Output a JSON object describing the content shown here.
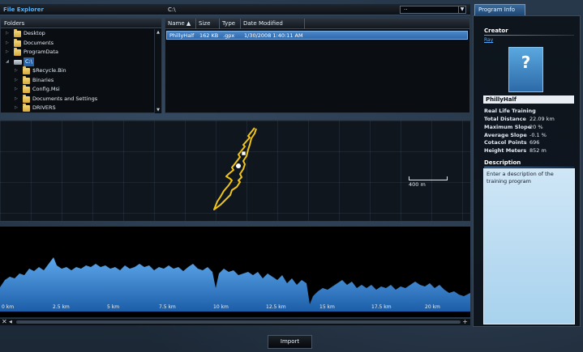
{
  "file_explorer": {
    "title": "File Explorer",
    "path": "C:\\",
    "dropdown_value": "··"
  },
  "folders": {
    "header": "Folders",
    "items": [
      {
        "label": "Desktop",
        "level": 0,
        "expander": "closed"
      },
      {
        "label": "Documents",
        "level": 0,
        "expander": "closed"
      },
      {
        "label": "ProgramData",
        "level": 0,
        "expander": "closed"
      },
      {
        "label": "C:\\",
        "level": 0,
        "expander": "open",
        "icon": "drive-icon",
        "selected": true
      },
      {
        "label": "$Recycle.Bin",
        "level": 1,
        "expander": "closed"
      },
      {
        "label": "Binaries",
        "level": 1,
        "expander": "closed"
      },
      {
        "label": "Config.Msi",
        "level": 1,
        "expander": "closed"
      },
      {
        "label": "Documents and Settings",
        "level": 1,
        "expander": "closed"
      },
      {
        "label": "DRIVERS",
        "level": 1,
        "expander": "closed"
      }
    ]
  },
  "files": {
    "columns": [
      "Name ▲",
      "Size",
      "Type",
      "Date Modified"
    ],
    "rows": [
      {
        "name": "PhillyHalf",
        "size": "162 KB",
        "type": ".gpx",
        "modified": "1/30/2008 1:40:11 AM"
      }
    ]
  },
  "map": {
    "scale_label": "400 m",
    "route_color": "#f0c418"
  },
  "profile": {
    "km_labels": [
      "0 km",
      "2.5 km",
      "5 km",
      "7.5 km",
      "10 km",
      "12.5 km",
      "15 km",
      "17.5 km",
      "20 km"
    ],
    "fill_top_color": "#5ea8ec",
    "fill_bottom_color": "#1c5ea8"
  },
  "import_label": "Import",
  "program_info": {
    "tab_label": "Program Info",
    "creator_title": "Creator",
    "creator_name": "Ray",
    "name_value": "PhillyHalf",
    "program_type": "Real Life Training",
    "stats": [
      {
        "label": "Total Distance",
        "value": "22.09 km"
      },
      {
        "label": "Maximum Slope",
        "value": "20 %"
      },
      {
        "label": "Average Slope",
        "value": "-0.1 %"
      },
      {
        "label": "Cotacol Points",
        "value": "696"
      },
      {
        "label": "Height Meters",
        "value": "852 m"
      }
    ],
    "description_title": "Description",
    "description_text": "Enter a description of the training program"
  },
  "colors": {
    "accent": "#4fb3ff",
    "selection": "#2f6aae"
  }
}
